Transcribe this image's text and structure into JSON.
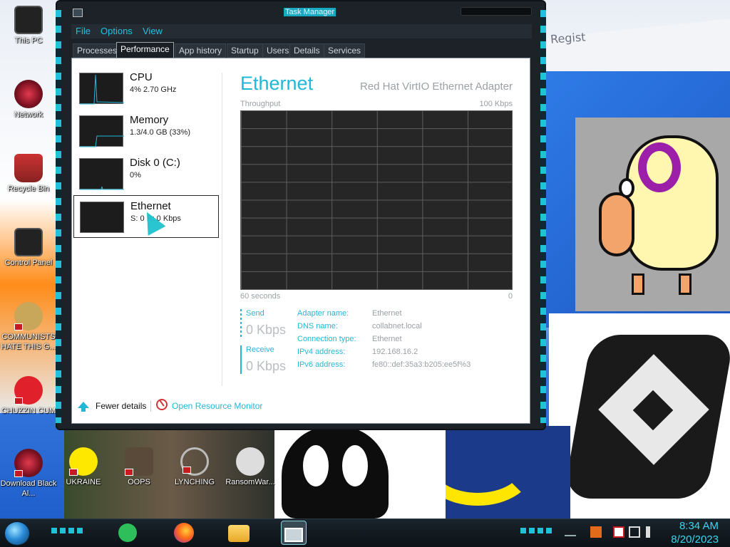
{
  "desktop": {
    "background_text": "Regist",
    "icons": [
      {
        "label": "This PC"
      },
      {
        "label": "Network"
      },
      {
        "label": "Recycle Bin"
      },
      {
        "label": "Control Panel"
      },
      {
        "label": "COMMUNISTS HATE THIS G..."
      },
      {
        "label": "CHUZZIN CUM"
      },
      {
        "label": "Download Black Al..."
      },
      {
        "label": "UKRAINE"
      },
      {
        "label": "OOPS"
      },
      {
        "label": "LYNCHING"
      },
      {
        "label": "RansomWar..."
      }
    ]
  },
  "task_manager": {
    "title": "Task Manager",
    "menu": [
      "File",
      "Options",
      "View"
    ],
    "tabs": [
      "Processes",
      "Performance",
      "App history",
      "Startup",
      "Users",
      "Details",
      "Services"
    ],
    "active_tab": "Performance",
    "resources": [
      {
        "name": "CPU",
        "detail": "4% 2.70 GHz"
      },
      {
        "name": "Memory",
        "detail": "1.3/4.0 GB (33%)"
      },
      {
        "name": "Disk 0 (C:)",
        "detail": "0%"
      },
      {
        "name": "Ethernet",
        "detail": "S: 0 R: 0 Kbps"
      }
    ],
    "selected_resource": "Ethernet",
    "panel": {
      "title": "Ethernet",
      "adapter": "Red Hat VirtIO Ethernet Adapter",
      "graph_label": "Throughput",
      "graph_max": "100 Kbps",
      "graph_time": "60 seconds",
      "graph_min": "0",
      "send_label": "Send",
      "send_value": "0 Kbps",
      "receive_label": "Receive",
      "receive_value": "0 Kbps",
      "details": [
        {
          "key": "Adapter name:",
          "value": "Ethernet"
        },
        {
          "key": "DNS name:",
          "value": "collabnet.local"
        },
        {
          "key": "Connection type:",
          "value": "Ethernet"
        },
        {
          "key": "IPv4 address:",
          "value": "192.168.16.2"
        },
        {
          "key": "IPv6 address:",
          "value": "fe80::def:35a3:b205:ee5f%3"
        }
      ]
    },
    "footer": {
      "fewer_details": "Fewer details",
      "open_resource_monitor": "Open Resource Monitor"
    },
    "accent_color": "#1fb9d8"
  },
  "taskbar": {
    "apps": [
      "notes-app",
      "firefox",
      "file-explorer",
      "task-manager"
    ],
    "active_app": "task-manager",
    "clock_time": "8:34 AM",
    "clock_date": "8/20/2023"
  }
}
